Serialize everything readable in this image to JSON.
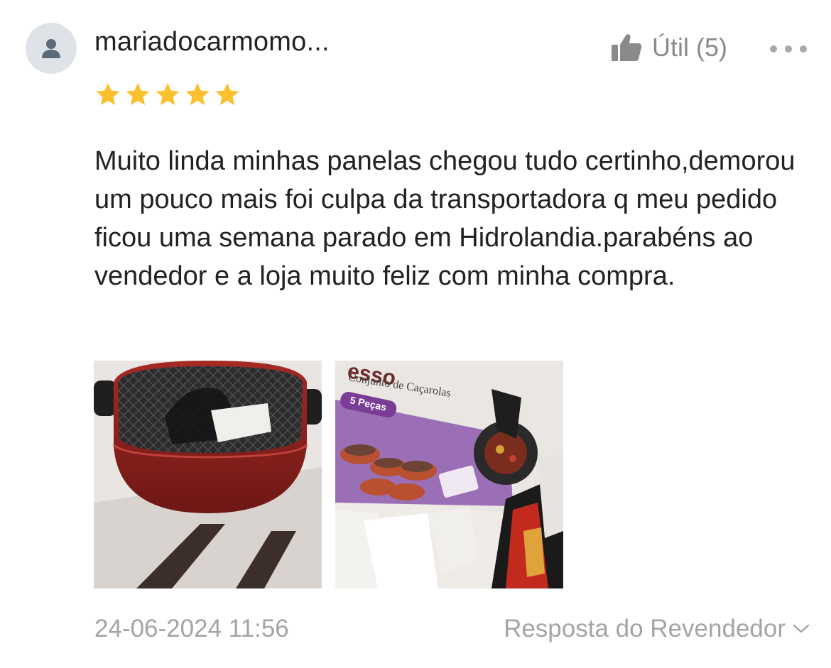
{
  "review": {
    "username": "mariadocarmomo...",
    "rating": 5,
    "rating_max": 5,
    "helpful_label": "Útil (5)",
    "text": "Muito linda minhas panelas chegou tudo certinho,demorou um pouco mais foi culpa da transportadora q meu pedido ficou uma semana parado em Hidrolandia.parabéns ao vendedor e a loja muito feliz com minha compra.",
    "date": "24-06-2024 11:56",
    "seller_reply_label": "Resposta do Revendedor",
    "photos": [
      {
        "name": "photo-red-pot"
      },
      {
        "name": "photo-cookware-box",
        "box_brand": "esso",
        "box_subtitle": "Conjunto de Caçarolas",
        "box_badge": "5 Peças"
      }
    ]
  },
  "colors": {
    "star": "#fbc02d",
    "text": "#222222",
    "muted": "#a4a4a4",
    "avatar_bg": "#dfe3e8",
    "avatar_icon": "#5b6b7a",
    "box_purple": "#9a6fb6",
    "pot_red": "#8f1f1c"
  }
}
